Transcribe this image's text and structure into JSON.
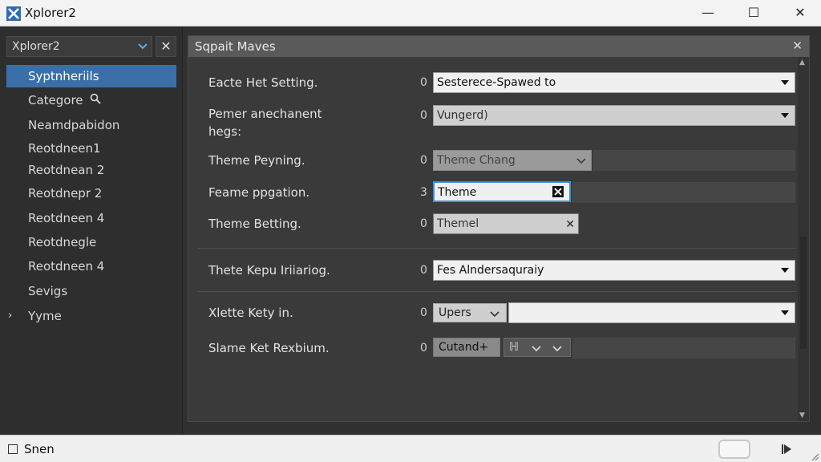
{
  "window": {
    "title": "Xplorer2",
    "minimize": "—",
    "maximize": "☐",
    "close": "✕"
  },
  "left": {
    "combo_value": "Xplorer2",
    "close_label": "✕",
    "items": [
      {
        "label": "Syptnheriils",
        "selected": true
      },
      {
        "label": "Categore",
        "icon": "search-icon"
      },
      {
        "label": "Neamdpabidon"
      },
      {
        "label": "Reotdneen1"
      },
      {
        "label": "Reotdnean 2"
      },
      {
        "label": "Reotdnepr 2"
      },
      {
        "label": "Reotdneen 4"
      },
      {
        "label": "Reotdnegle"
      },
      {
        "label": "Reotdneen 4"
      },
      {
        "label": "Sevigs"
      },
      {
        "label": "Yyme",
        "caret": "›"
      }
    ]
  },
  "panel": {
    "title": "Sqpait Maves",
    "close_label": "✕",
    "rows": [
      {
        "label": "Eacte Het Setting.",
        "zero": "0",
        "value": "Sesterece-Spawed to"
      },
      {
        "label": "Pemer anechanent\nhegs:",
        "zero": "0",
        "value": "Vungerd)"
      },
      {
        "label": "Theme Peyning.",
        "zero": "0",
        "value": "Theme Chang"
      },
      {
        "label": "Feame ppgation.",
        "zero": "3",
        "value": "Theme"
      },
      {
        "label": "Theme Betting.",
        "zero": "0",
        "value": "Themel"
      },
      {
        "label": "Thete Kepu Iriiariog.",
        "zero": "0",
        "value": "Fes Alndersaquraiy"
      },
      {
        "label": "Xlette Kety in.",
        "zero": "0",
        "value": "Upers"
      },
      {
        "label": "Slame Ket Rexbium.",
        "zero": "0",
        "value": "Cutand+",
        "extra": "ℍ"
      }
    ]
  },
  "status": {
    "text": "Snen"
  },
  "colors": {
    "selection": "#3a6fa8",
    "focus": "#3b8ee0",
    "panel_header": "#5a5a5a"
  }
}
